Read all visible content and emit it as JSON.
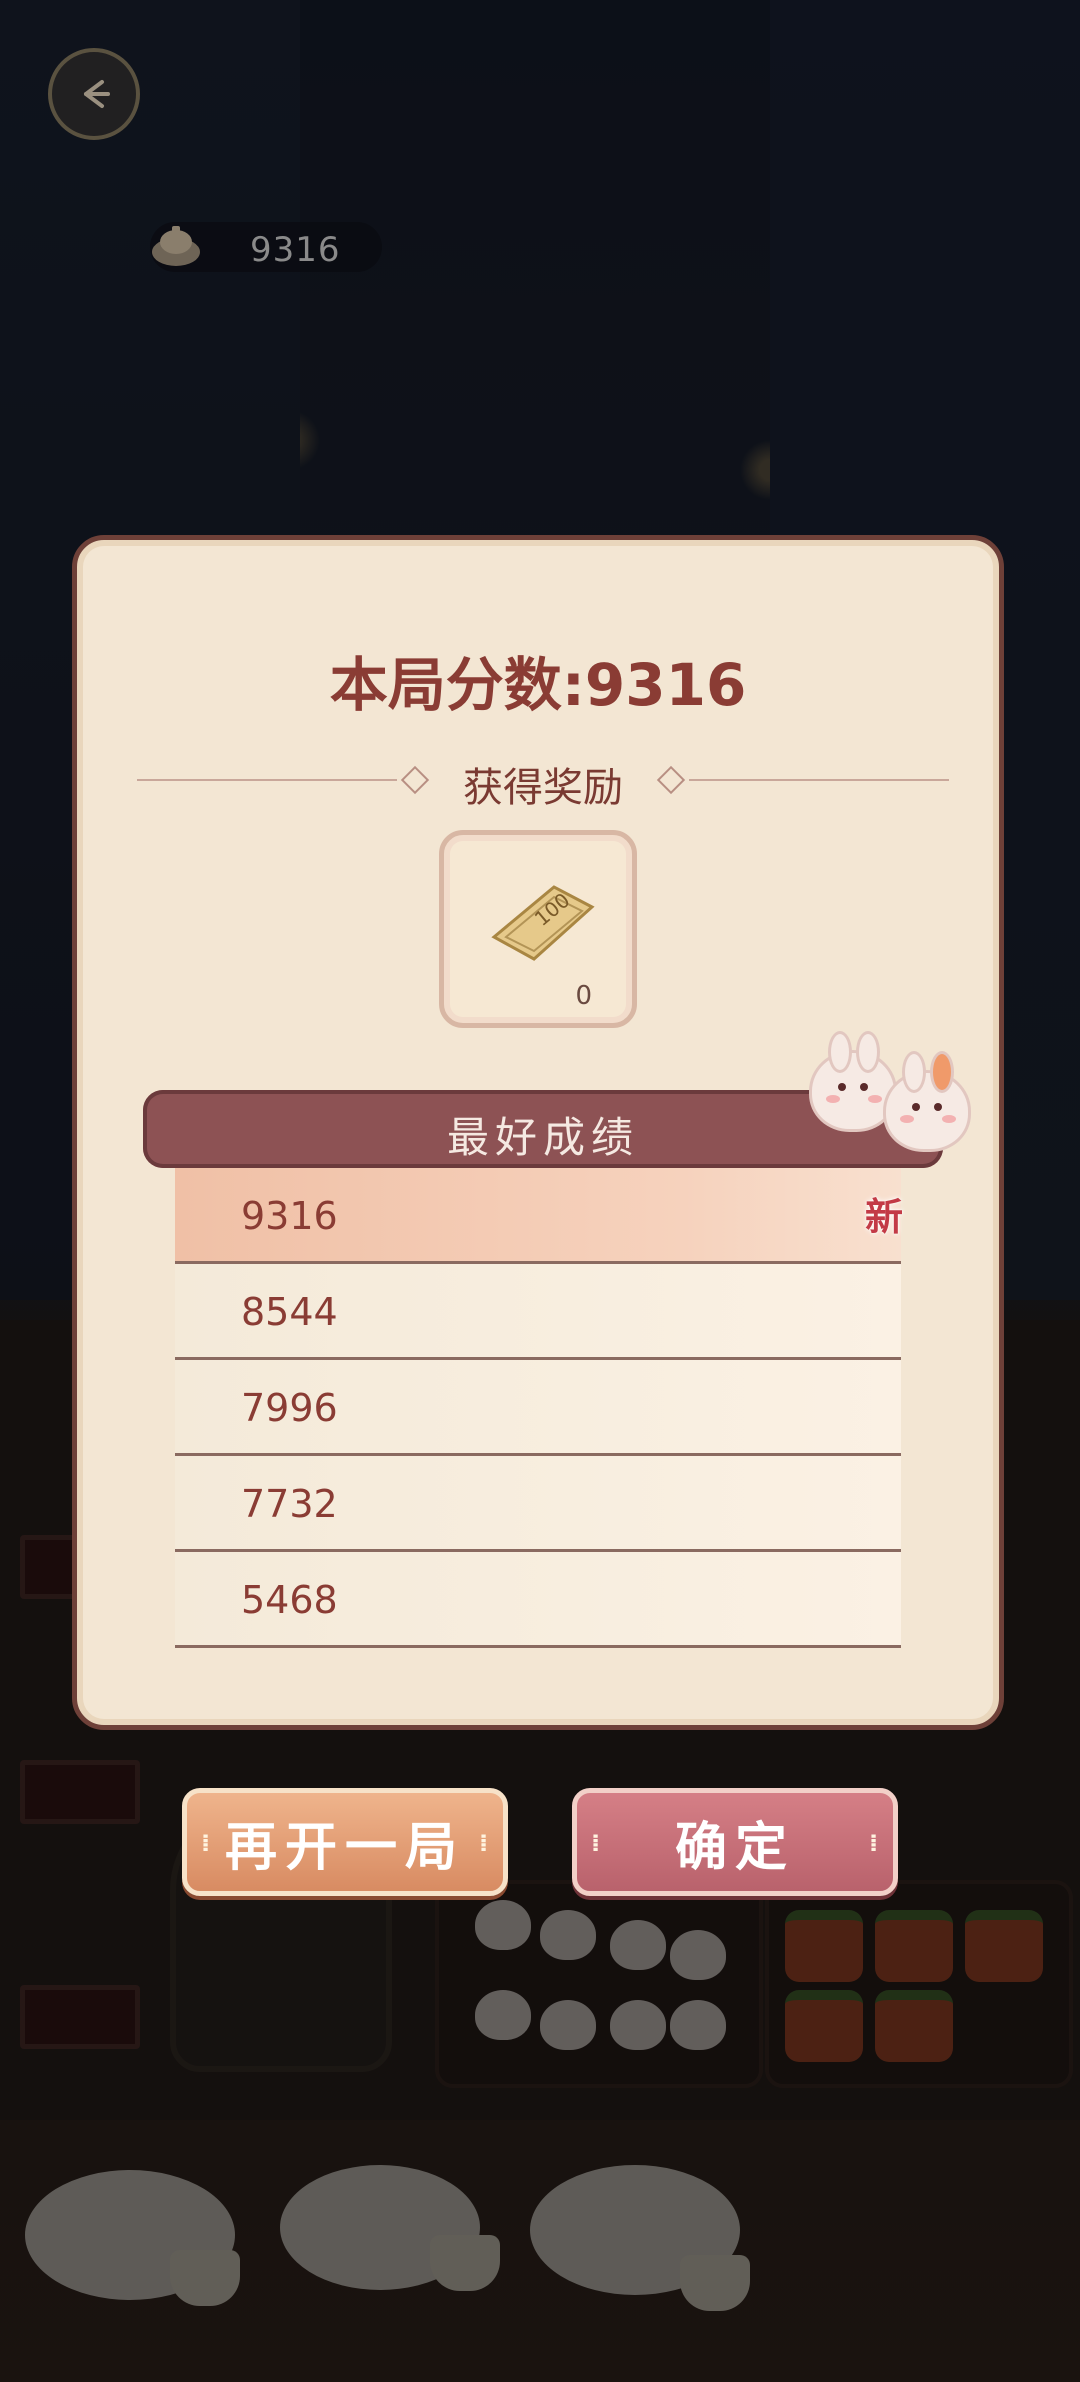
{
  "hud": {
    "coins": "9316",
    "back_icon": "back-arrow-icon",
    "coin_icon": "teapot-coin-icon"
  },
  "panel": {
    "score_title": "本局分数:9316",
    "reward_label": "获得奖励",
    "reward_item": {
      "icon": "ticket-100-icon",
      "ticket_text": "100",
      "count": "0"
    },
    "best_title": "最好成绩",
    "new_badge": "新",
    "best_scores": [
      "9316",
      "8544",
      "7996",
      "7732",
      "5468"
    ]
  },
  "buttons": {
    "restart": "再开一局",
    "confirm": "确定"
  },
  "colors": {
    "panel_bg": "#f3e6d3",
    "title_red": "#8a3c34",
    "banner": "#8d5254",
    "restart_btn": "#e4a076",
    "confirm_btn": "#c86f78"
  }
}
